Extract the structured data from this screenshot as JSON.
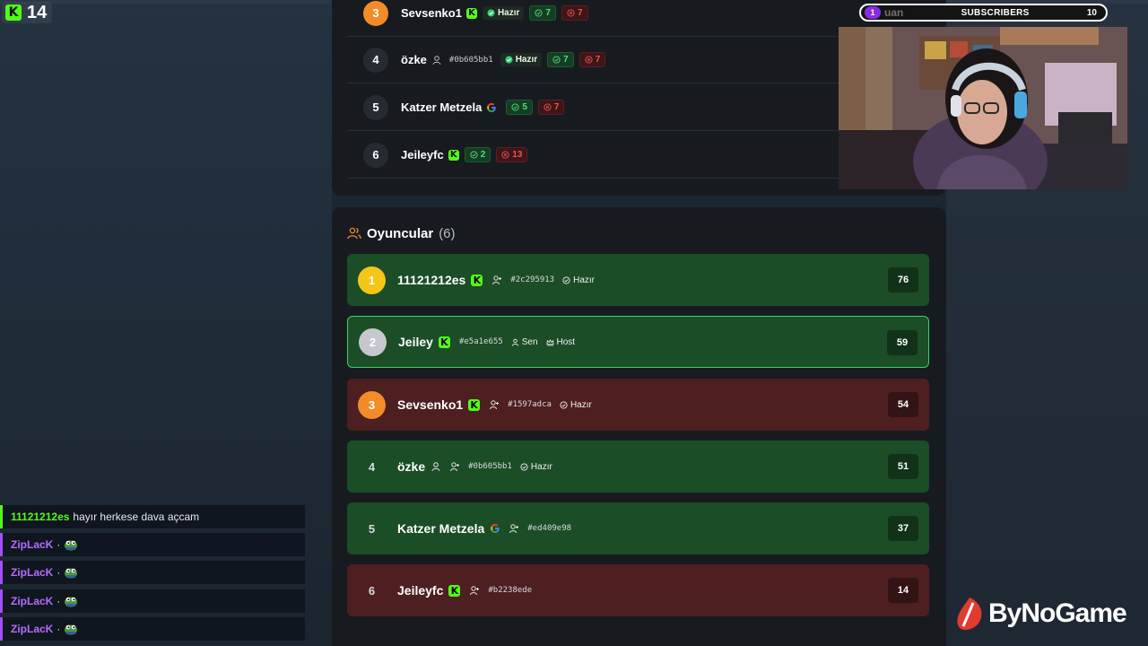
{
  "kick_badge": {
    "count": "14",
    "logo": "K"
  },
  "top_rows": [
    {
      "rank": "3",
      "name": "Sevsenko1",
      "platform": "kick",
      "hash": "",
      "ready": "Hazır",
      "wins": "7",
      "losses": "7"
    },
    {
      "rank": "4",
      "name": "özke",
      "platform": "user",
      "hash": "#0b605bb1",
      "ready": "Hazır",
      "wins": "7",
      "losses": "7"
    },
    {
      "rank": "5",
      "name": "Katzer Metzela",
      "platform": "google",
      "hash": "",
      "ready": "",
      "wins": "5",
      "losses": "7"
    },
    {
      "rank": "6",
      "name": "Jeileyfc",
      "platform": "kick",
      "hash": "",
      "ready": "",
      "wins": "2",
      "losses": "13"
    }
  ],
  "players": {
    "title": "Oyuncular",
    "count": "(6)",
    "items": [
      {
        "rank": "1",
        "name": "11121212es",
        "platform": "kick",
        "hash": "#2c295913",
        "tags": [
          "Hazır"
        ],
        "score": "76"
      },
      {
        "rank": "2",
        "name": "Jeiley",
        "platform": "kick",
        "hash": "#e5a1e655",
        "tags": [
          "Sen",
          "Host"
        ],
        "score": "59"
      },
      {
        "rank": "3",
        "name": "Sevsenko1",
        "platform": "kick",
        "hash": "#1597adca",
        "tags": [
          "Hazır"
        ],
        "score": "54"
      },
      {
        "rank": "4",
        "name": "özke",
        "platform": "user",
        "hash": "#0b605bb1",
        "tags": [
          "Hazır"
        ],
        "score": "51"
      },
      {
        "rank": "5",
        "name": "Katzer Metzela",
        "platform": "google",
        "hash": "#ed409e98",
        "tags": [],
        "score": "37"
      },
      {
        "rank": "6",
        "name": "Jeileyfc",
        "platform": "kick",
        "hash": "#b2238ede",
        "tags": [],
        "score": "14"
      }
    ]
  },
  "subs": {
    "badge": "1",
    "user": "uan",
    "label": "SUBSCRIBERS",
    "value": "10"
  },
  "chat": [
    {
      "user": "11121212es",
      "text": "hayır herkese dava açcam",
      "emote": false
    },
    {
      "user": "ZipLacK",
      "text": "·",
      "emote": true
    },
    {
      "user": "ZipLacK",
      "text": "·",
      "emote": true
    },
    {
      "user": "ZipLacK",
      "text": "·",
      "emote": true
    },
    {
      "user": "ZipLacK",
      "text": "·",
      "emote": true
    }
  ],
  "brand": {
    "name": "ByNoGame"
  },
  "colors": {
    "kick": "#53fc18",
    "win": "#4ade80",
    "loss": "#f05252",
    "card_green": "#1b4d27",
    "card_red": "#4e1f20",
    "chat_purple": "#b66bff"
  },
  "icons": [
    "kick-logo-icon",
    "user-icon",
    "add-friend-icon",
    "check-circle-icon",
    "x-circle-icon",
    "google-icon",
    "crown-icon",
    "players-icon",
    "frog-emote-icon",
    "bynogame-logo-icon"
  ]
}
